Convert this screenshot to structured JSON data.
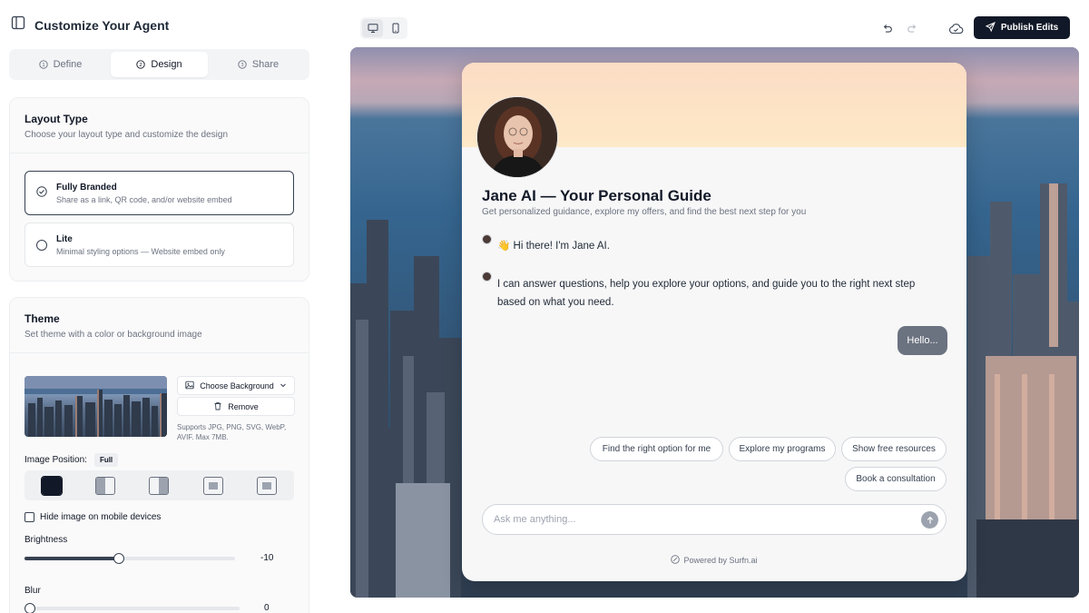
{
  "app": {
    "title": "Customize Your Agent"
  },
  "tabs": [
    {
      "label": "Define",
      "active": false
    },
    {
      "label": "Design",
      "active": true
    },
    {
      "label": "Share",
      "active": false
    }
  ],
  "layout": {
    "title": "Layout Type",
    "subtitle": "Choose your layout type and customize the design",
    "options": [
      {
        "title": "Fully Branded",
        "desc": "Share as a link, QR code, and/or website embed",
        "selected": true
      },
      {
        "title": "Lite",
        "desc": "Minimal styling options — Website embed only",
        "selected": false
      }
    ]
  },
  "theme": {
    "title": "Theme",
    "subtitle": "Set theme with a color or background image",
    "choose_bg": "Choose Background",
    "remove": "Remove",
    "hint": "Supports JPG, PNG, SVG, WebP, AVIF. Max 7MB.",
    "image_position_label": "Image Position:",
    "image_position_value": "Full",
    "hide_mobile": "Hide image on mobile devices",
    "brightness_label": "Brightness",
    "brightness_value": "-10",
    "brightness_fraction": 0.45,
    "blur_label": "Blur",
    "blur_value": "0",
    "blur_fraction": 0.0
  },
  "toolbar": {
    "publish": "Publish Edits"
  },
  "chat": {
    "name": "Jane AI — Your Personal Guide",
    "subtitle": "Get personalized guidance, explore my offers, and find the best next step for you",
    "messages": [
      "👋 Hi there! I'm Jane AI.",
      "I can answer questions, help you explore your options, and guide you to the right next step based on what you need."
    ],
    "user_message": "Hello...",
    "suggestions": [
      "Find the right option for me",
      "Explore my programs",
      "Show free resources",
      "Book a consultation"
    ],
    "input_placeholder": "Ask me anything...",
    "powered": "Powered by Surfn.ai"
  },
  "colors": {
    "primary": "#111827",
    "accent_gradient_top": "#fcdcc5"
  }
}
